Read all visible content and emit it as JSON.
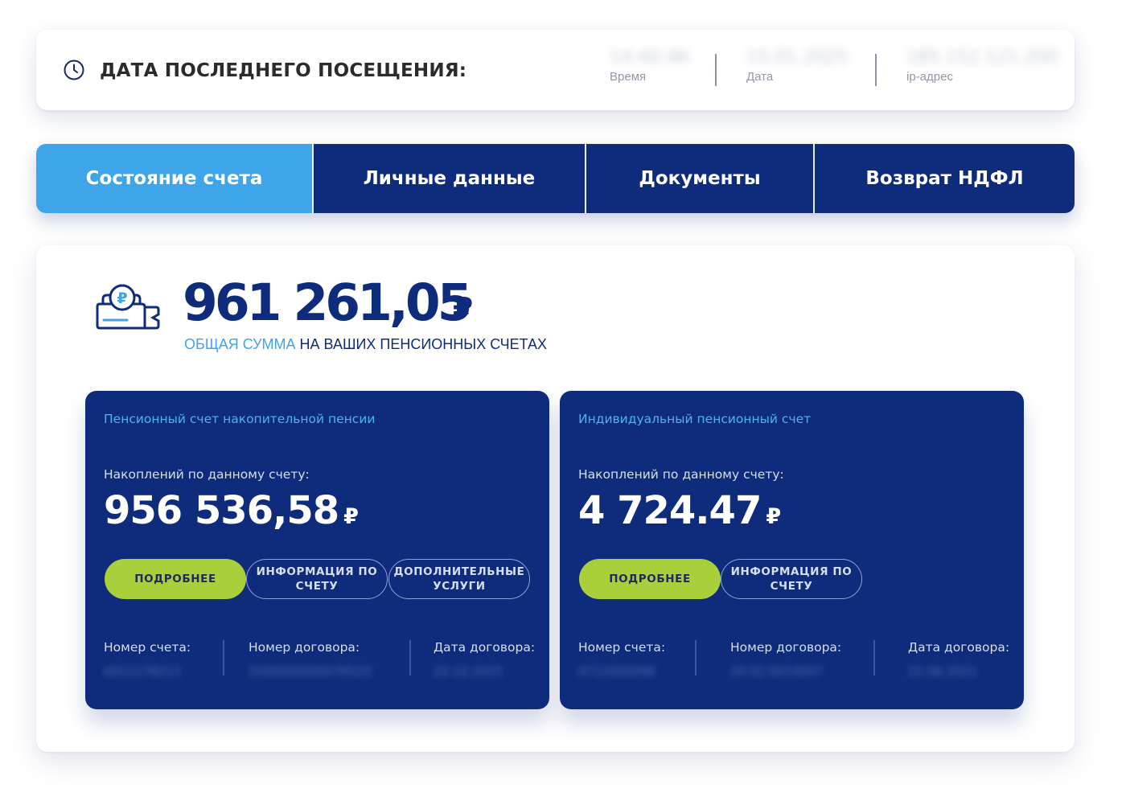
{
  "last_visit": {
    "title": "ДАТА ПОСЛЕДНЕГО ПОСЕЩЕНИЯ:",
    "time_value": "14:40:46",
    "time_label": "Время",
    "date_value": "15.01.2025",
    "date_label": "Дата",
    "ip_value": "185.152.121.200",
    "ip_label": "ip-адрес"
  },
  "tabs": [
    {
      "label": "Состояние счета",
      "active": true
    },
    {
      "label": "Личные данные",
      "active": false
    },
    {
      "label": "Документы",
      "active": false
    },
    {
      "label": "Возврат НДФЛ",
      "active": false
    }
  ],
  "summary": {
    "total_amount": "961 261,05",
    "currency": "₽",
    "caption_accent": "ОБЩАЯ СУММА",
    "caption_rest": " НА ВАШИХ ПЕНСИОННЫХ СЧЕТАХ"
  },
  "accounts": [
    {
      "title": "Пенсионный счет накопительной пенсии",
      "subtitle": "Накоплений по данному счету:",
      "amount": "956 536,58",
      "currency": "₽",
      "buttons": [
        "ПОДРОБНЕЕ",
        "ИНФОРМАЦИЯ ПО СЧЕТУ",
        "ДОПОЛНИТЕЛЬНЫЕ УСЛУГИ"
      ],
      "account_label": "Номер счета:",
      "account_value": "0011178213",
      "contract_label": "Номер договора:",
      "contract_value": "1000000000078523",
      "date_label": "Дата договора:",
      "date_value": "22.12.2015"
    },
    {
      "title": "Индивидуальный пенсионный счет",
      "subtitle": "Накоплений по данному счету:",
      "amount": "4 724.47",
      "currency": "₽",
      "buttons": [
        "ПОДРОБНЕЕ",
        "ИНФОРМАЦИЯ ПО СЧЕТУ"
      ],
      "account_label": "Номер счета:",
      "account_value": "0711000099",
      "contract_label": "Номер договора:",
      "contract_value": "20.02.0010007",
      "date_label": "Дата договора:",
      "date_value": "22.06.2021"
    }
  ],
  "colors": {
    "navy": "#0f2c7c",
    "light_blue": "#3ea5e8",
    "green": "#a9cf3b"
  }
}
